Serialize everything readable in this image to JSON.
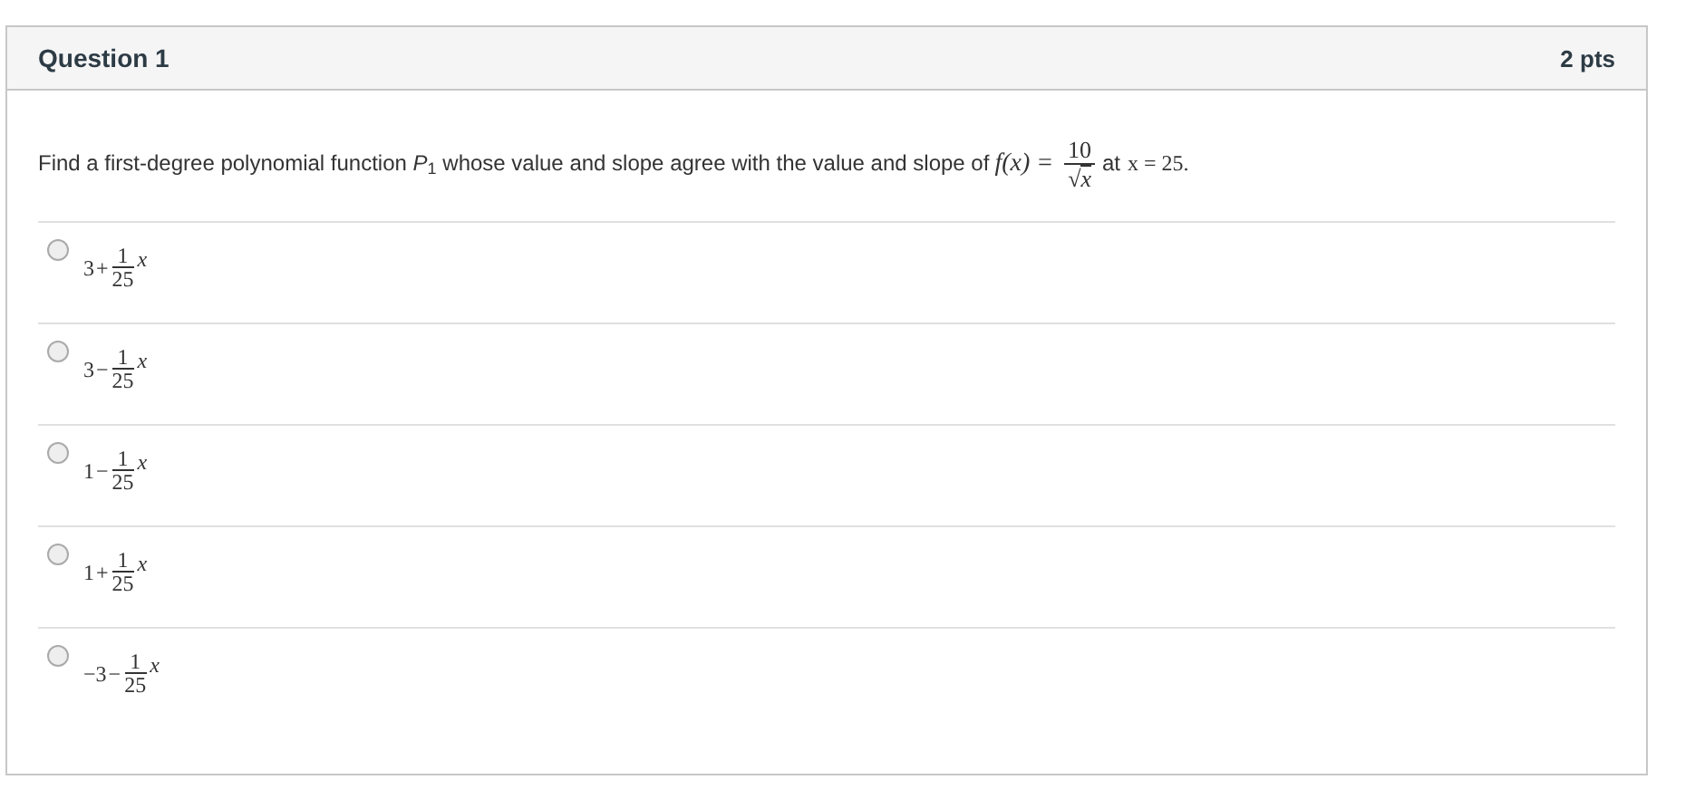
{
  "header": {
    "title": "Question 1",
    "points": "2 pts"
  },
  "question": {
    "text": "Find a first-degree polynomial function *P*$_{1}$ whose value and slope agree with the value and slope of",
    "lhs": "f(x) =",
    "numerator": "10",
    "radical": "√",
    "radicand": "x",
    "connector": "at",
    "point": "x = 25."
  },
  "options": [
    {
      "constant": "3",
      "operator": "+",
      "numerator": "1",
      "denominator": "25",
      "variable": "x",
      "selected": false
    },
    {
      "constant": "3",
      "operator": "−",
      "numerator": "1",
      "denominator": "25",
      "variable": "x",
      "selected": false
    },
    {
      "constant": "1",
      "operator": "−",
      "numerator": "1",
      "denominator": "25",
      "variable": "x",
      "selected": false
    },
    {
      "constant": "1",
      "operator": "+",
      "numerator": "1",
      "denominator": "25",
      "variable": "x",
      "selected": false
    },
    {
      "constant": "−3",
      "operator": "−",
      "numerator": "1",
      "denominator": "25",
      "variable": "x",
      "selected": false
    }
  ]
}
